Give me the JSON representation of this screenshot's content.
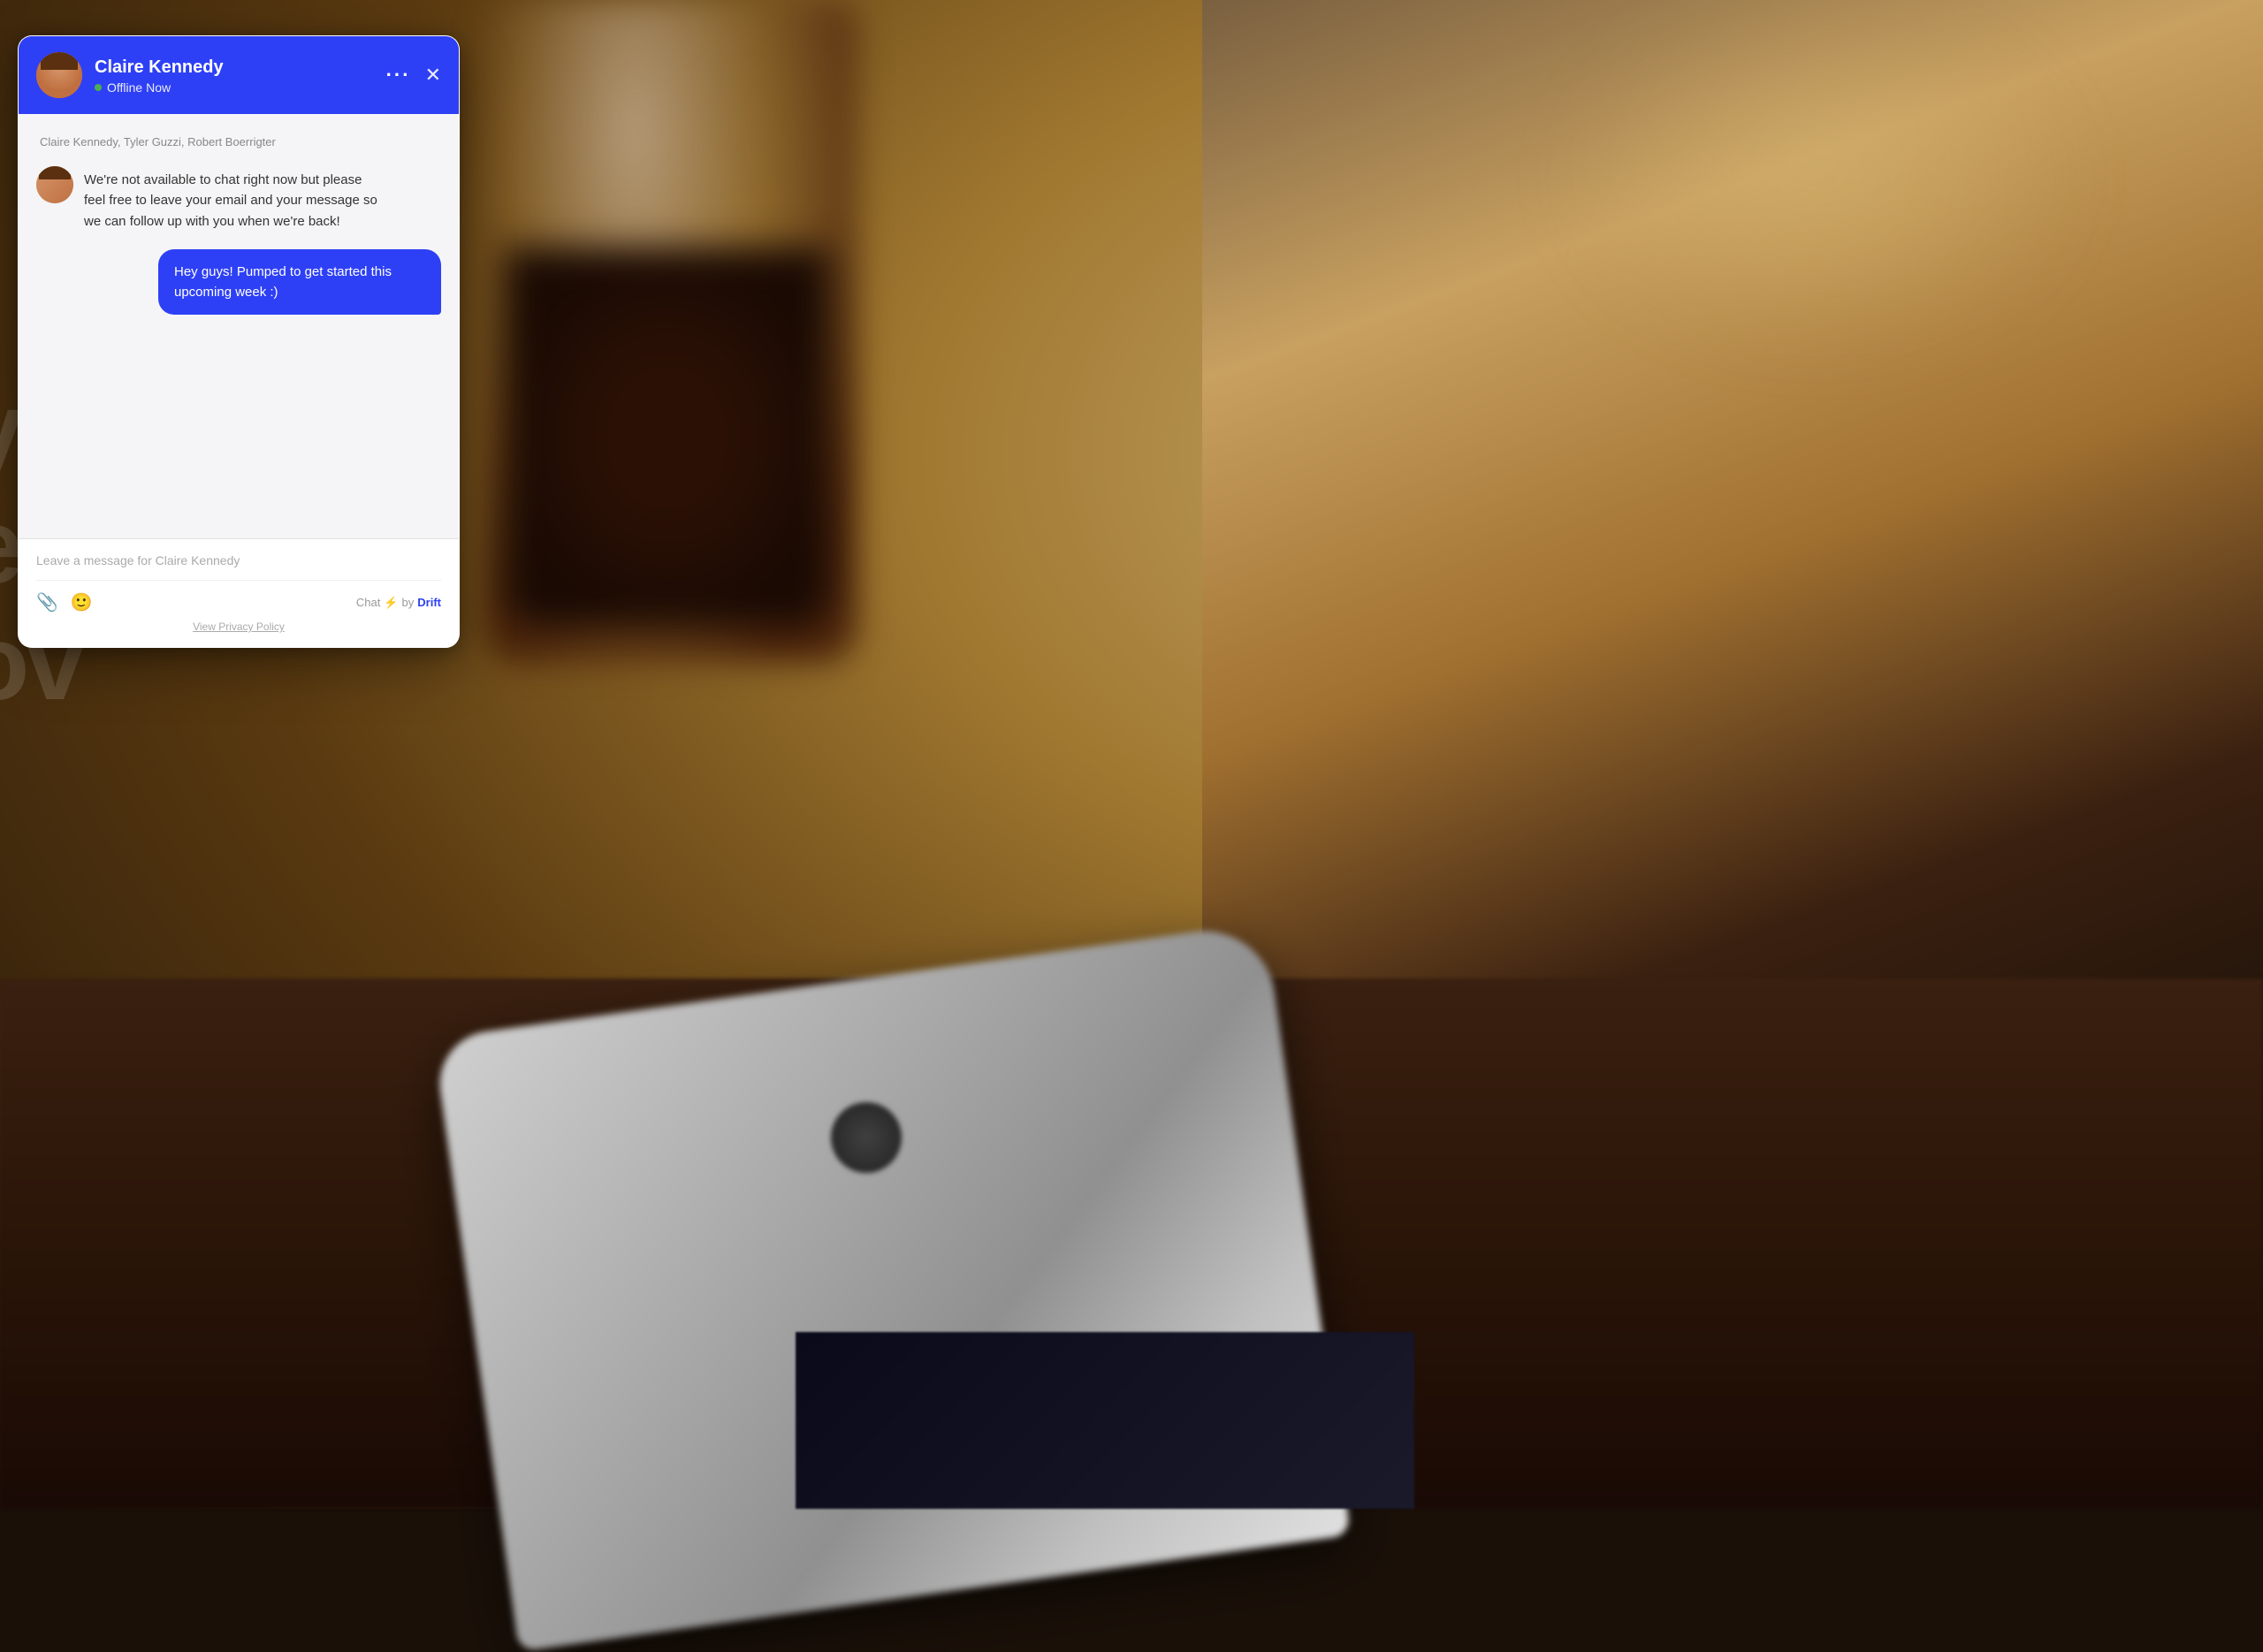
{
  "background": {
    "description": "Blurred coffee shop scene with jar, phone, and wooden table"
  },
  "chat_widget": {
    "header": {
      "name": "Claire Kennedy",
      "status": "Offline Now",
      "status_dot_color": "#4CAF50",
      "background_color": "#2E40F5",
      "dots_label": "···",
      "close_label": "✕"
    },
    "agents_line": "Claire Kennedy, Tyler Guzzi, Robert Boerrigter",
    "messages": [
      {
        "type": "incoming",
        "text": "We're not available to chat right now but please feel free to leave your email and your message so we can follow up with you when we're back!",
        "has_avatar": true
      },
      {
        "type": "outgoing",
        "text": "Hey guys! Pumped to get started this upcoming week :)",
        "bubble_color": "#2E40F5"
      }
    ],
    "footer": {
      "input_placeholder": "Leave a message for Claire Kennedy",
      "chat_label": "Chat",
      "powered_by": "by",
      "drift_label": "Drift",
      "bolt": "⚡",
      "privacy_label": "View Privacy Policy"
    }
  },
  "side_overlay": {
    "lines": [
      "yo",
      "eo",
      "ov"
    ]
  }
}
